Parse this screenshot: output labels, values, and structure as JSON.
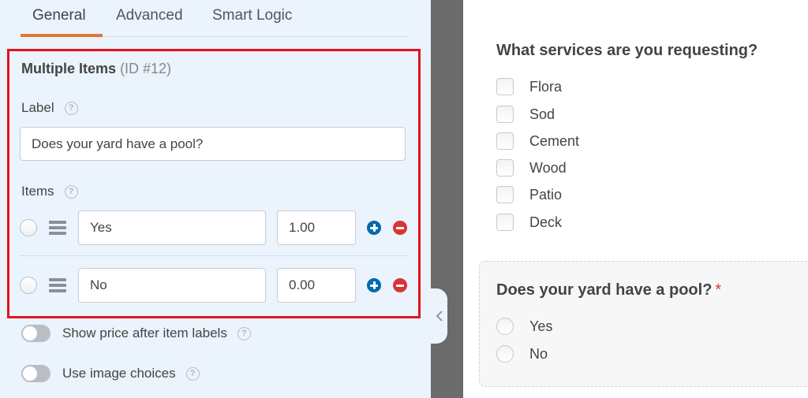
{
  "tabs": [
    {
      "label": "General",
      "active": true
    },
    {
      "label": "Advanced",
      "active": false
    },
    {
      "label": "Smart Logic",
      "active": false
    }
  ],
  "field": {
    "title": "Multiple Items",
    "id_text": "(ID #12)",
    "label_heading": "Label",
    "label_value": "Does your yard have a pool?",
    "items_heading": "Items",
    "choices": [
      {
        "label": "Yes",
        "value": "1.00"
      },
      {
        "label": "No",
        "value": "0.00"
      }
    ],
    "toggles": [
      {
        "label": "Show price after item labels",
        "on": false
      },
      {
        "label": "Use image choices",
        "on": false
      }
    ]
  },
  "icons": {
    "help": "?",
    "add": "plus-circle-icon",
    "remove": "minus-circle-icon",
    "drag": "drag-handle-icon",
    "collapse": "chevron-left-icon"
  },
  "colors": {
    "accent_tab": "#e27730",
    "highlight_border": "#e3141b",
    "add_button": "#036aab",
    "remove_button": "#d63638",
    "required": "#d63638"
  },
  "preview": {
    "services_question": "What services are you requesting?",
    "services_options": [
      "Flora",
      "Sod",
      "Cement",
      "Wood",
      "Patio",
      "Deck"
    ],
    "pool_question": "Does your yard have a pool?",
    "required_mark": "*",
    "pool_options": [
      "Yes",
      "No"
    ]
  }
}
